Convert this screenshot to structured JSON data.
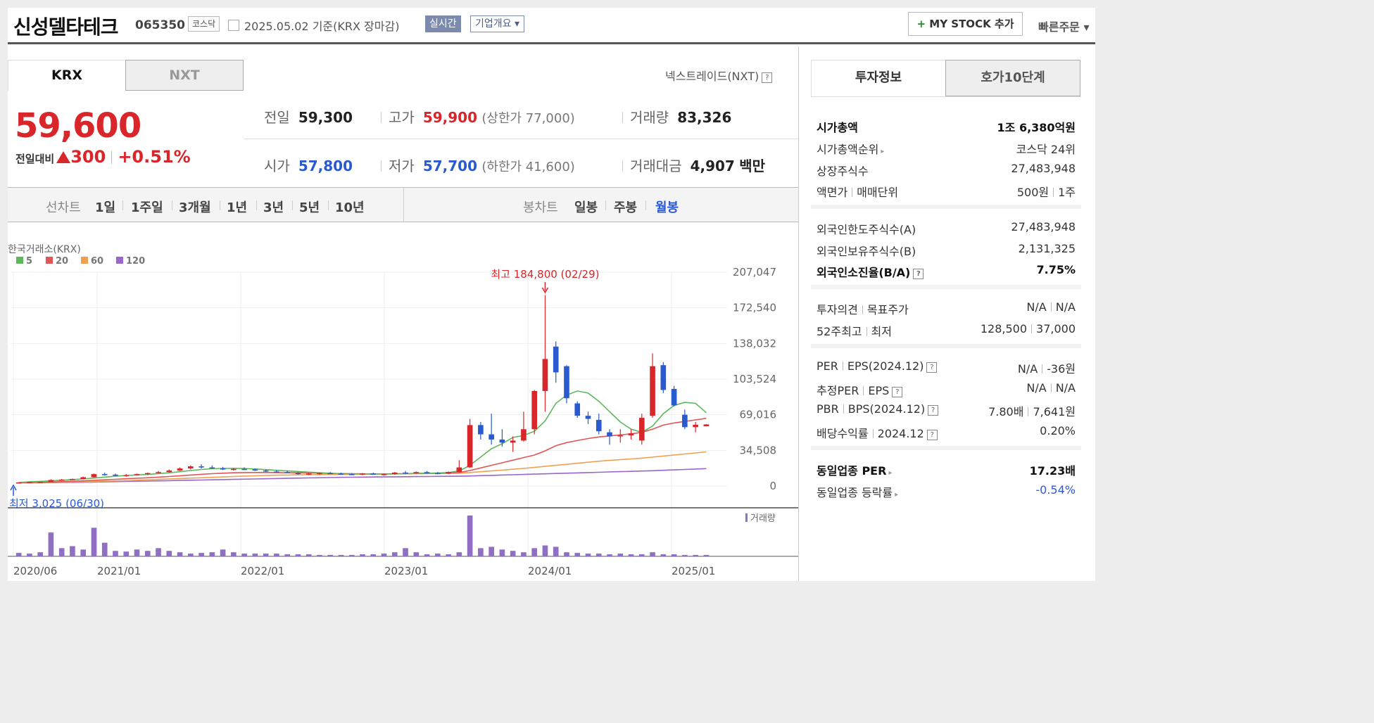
{
  "header": {
    "name": "신성델타테크",
    "code": "065350",
    "market": "코스닥",
    "date": "2025.05.02  기준(KRX 장마감)",
    "realtime_label": "실시간",
    "corp_label": "기업개요 ▾",
    "mystock_plus": "+",
    "mystock_label": "MY STOCK 추가",
    "quick_label": "빠른주문 ▾"
  },
  "tabs": {
    "krx": "KRX",
    "nxt": "NXT",
    "nxt_link": "넥스트레이드(NXT)",
    "help": "?"
  },
  "price": {
    "current": "59,600",
    "change_label": "전일대비",
    "change": "300",
    "rate": "+0.51%"
  },
  "quote": {
    "prev_label": "전일",
    "prev": "59,300",
    "high_label": "고가",
    "high": "59,900",
    "upper": "(상한가 77,000)",
    "volume_label": "거래량",
    "volume": "83,326",
    "open_label": "시가",
    "open": "57,800",
    "low_label": "저가",
    "low": "57,700",
    "lower": "(하한가 41,600)",
    "amount_label": "거래대금",
    "amount": "4,907",
    "amount_unit": "백만"
  },
  "periods": {
    "line_label": "선차트",
    "line_items": [
      "1일",
      "1주일",
      "3개월",
      "1년",
      "3년",
      "5년",
      "10년"
    ],
    "candle_label": "봉차트",
    "candle_items": [
      "일봉",
      "주봉",
      "월봉"
    ],
    "selected": "월봉"
  },
  "chart_data": {
    "type": "candlestick",
    "source_label": "한국거래소(KRX)",
    "legend": [
      {
        "name": "5",
        "color": "#5cb85c"
      },
      {
        "name": "20",
        "color": "#e05555"
      },
      {
        "name": "60",
        "color": "#f0a050"
      },
      {
        "name": "120",
        "color": "#9966cc"
      }
    ],
    "y_ticks": [
      "207,047",
      "172,540",
      "138,032",
      "103,524",
      "69,016",
      "34,508",
      "0"
    ],
    "ylim": [
      0,
      207047
    ],
    "x_ticks": [
      "2020/06",
      "2021/01",
      "2022/01",
      "2023/01",
      "2024/01",
      "2025/01"
    ],
    "max_label": "최고 184,800 (02/29)",
    "min_label": "최저 3,025 (06/30)",
    "volume_label": "거래량",
    "up_color": "#d8262b",
    "down_color": "#2a5ad0",
    "candles": [
      [
        3100,
        3500,
        3000,
        3400
      ],
      [
        3400,
        4000,
        3300,
        3800
      ],
      [
        3800,
        4200,
        3500,
        3900
      ],
      [
        3900,
        6500,
        3800,
        5800
      ],
      [
        5800,
        6800,
        5200,
        6200
      ],
      [
        6200,
        7200,
        5800,
        6800
      ],
      [
        6800,
        9000,
        6500,
        8500
      ],
      [
        8500,
        12000,
        8000,
        11500
      ],
      [
        11500,
        13000,
        10000,
        11000
      ],
      [
        11000,
        12000,
        9500,
        10000
      ],
      [
        10000,
        11500,
        9000,
        10500
      ],
      [
        10500,
        12000,
        10000,
        11500
      ],
      [
        11500,
        13000,
        10500,
        12500
      ],
      [
        12500,
        14500,
        12000,
        13500
      ],
      [
        13500,
        16000,
        13000,
        15000
      ],
      [
        15000,
        18000,
        14500,
        17000
      ],
      [
        17000,
        20000,
        16000,
        19000
      ],
      [
        19000,
        21000,
        17000,
        18000
      ],
      [
        18000,
        20000,
        16500,
        17000
      ],
      [
        17000,
        18500,
        15500,
        16000
      ],
      [
        16000,
        17500,
        15000,
        16500
      ],
      [
        16500,
        18000,
        15500,
        16000
      ],
      [
        16000,
        17000,
        14500,
        15000
      ],
      [
        15000,
        16000,
        13500,
        14000
      ],
      [
        14000,
        15500,
        13000,
        13500
      ],
      [
        13500,
        15000,
        12500,
        12500
      ],
      [
        12500,
        13500,
        11000,
        11500
      ],
      [
        11500,
        12500,
        10500,
        12000
      ],
      [
        12000,
        13000,
        11000,
        12500
      ],
      [
        12500,
        13500,
        11500,
        12000
      ],
      [
        12000,
        13000,
        11000,
        11500
      ],
      [
        11500,
        12500,
        10500,
        11000
      ],
      [
        11000,
        12500,
        10500,
        12000
      ],
      [
        12000,
        13000,
        11000,
        11000
      ],
      [
        11000,
        12000,
        10000,
        11500
      ],
      [
        11500,
        13500,
        11000,
        13000
      ],
      [
        13000,
        14500,
        12000,
        12500
      ],
      [
        12500,
        14000,
        12000,
        13500
      ],
      [
        13500,
        14500,
        12000,
        12500
      ],
      [
        12500,
        13500,
        11500,
        12000
      ],
      [
        12000,
        14000,
        11500,
        13500
      ],
      [
        13500,
        25000,
        13000,
        18000
      ],
      [
        18000,
        65000,
        17500,
        59000
      ],
      [
        59000,
        62000,
        45000,
        50000
      ],
      [
        50000,
        70000,
        40000,
        45000
      ],
      [
        45000,
        55000,
        38000,
        42000
      ],
      [
        42000,
        48000,
        33000,
        44000
      ],
      [
        44000,
        72000,
        43000,
        55000
      ],
      [
        55000,
        93000,
        50000,
        92000
      ],
      [
        92000,
        184800,
        72000,
        123000
      ],
      [
        135000,
        140000,
        100000,
        110000
      ],
      [
        116000,
        117000,
        80000,
        85000
      ],
      [
        80000,
        82000,
        66000,
        68000
      ],
      [
        68000,
        72000,
        60000,
        65000
      ],
      [
        64000,
        70000,
        50000,
        53000
      ],
      [
        52000,
        55000,
        40000,
        48000
      ],
      [
        48000,
        55000,
        42000,
        49000
      ],
      [
        49000,
        55000,
        45000,
        51000
      ],
      [
        44000,
        70000,
        40000,
        66000
      ],
      [
        68000,
        128500,
        66000,
        116000
      ],
      [
        117000,
        120000,
        90000,
        93000
      ],
      [
        94000,
        97000,
        77000,
        78000
      ],
      [
        69000,
        74000,
        55000,
        57000
      ],
      [
        57000,
        62000,
        52000,
        59300
      ],
      [
        57800,
        59900,
        57700,
        59600
      ]
    ],
    "ma5": [
      3400,
      4000,
      4500,
      5000,
      5600,
      6200,
      6900,
      7700,
      8600,
      9500,
      10100,
      10700,
      11200,
      12000,
      12800,
      13800,
      15000,
      16000,
      16700,
      17000,
      17100,
      16900,
      16500,
      15900,
      15200,
      14600,
      14000,
      13400,
      12800,
      12300,
      12000,
      11800,
      11700,
      11600,
      11600,
      11700,
      11900,
      12200,
      12400,
      12600,
      13000,
      14500,
      20000,
      28000,
      36000,
      41000,
      47000,
      49000,
      53000,
      63000,
      80000,
      88000,
      92000,
      90000,
      82000,
      72000,
      62000,
      55000,
      52000,
      58000,
      70000,
      78000,
      81000,
      80000,
      71000
    ],
    "ma20": [
      3200,
      3400,
      3600,
      3900,
      4200,
      4600,
      5000,
      5500,
      6000,
      6500,
      7000,
      7500,
      8000,
      8600,
      9200,
      9900,
      10600,
      11300,
      11900,
      12400,
      12800,
      13000,
      13100,
      13100,
      13000,
      12900,
      12800,
      12600,
      12400,
      12200,
      12000,
      11900,
      11800,
      11700,
      11700,
      11800,
      11900,
      12100,
      12300,
      12400,
      12600,
      13000,
      15000,
      17500,
      20000,
      22500,
      25000,
      27500,
      30000,
      34000,
      39000,
      42000,
      44000,
      46000,
      47500,
      48500,
      49500,
      50500,
      52000,
      55000,
      59000,
      61000,
      62500,
      64000,
      65500
    ],
    "ma60": [
      3100,
      3200,
      3300,
      3400,
      3600,
      3800,
      4000,
      4300,
      4600,
      4900,
      5200,
      5600,
      6000,
      6400,
      6800,
      7200,
      7600,
      8000,
      8400,
      8800,
      9200,
      9600,
      9900,
      10200,
      10400,
      10600,
      10800,
      10900,
      11000,
      11100,
      11200,
      11300,
      11400,
      11500,
      11600,
      11700,
      11800,
      11900,
      12000,
      12100,
      12200,
      12400,
      13000,
      13800,
      14600,
      15400,
      16200,
      17000,
      18000,
      19000,
      20000,
      21000,
      22000,
      23000,
      24000,
      24800,
      25500,
      26200,
      27000,
      28000,
      29000,
      30000,
      31000,
      32000,
      33000
    ],
    "ma120": [
      3000,
      3100,
      3200,
      3300,
      3400,
      3500,
      3600,
      3800,
      4000,
      4200,
      4400,
      4600,
      4800,
      5000,
      5200,
      5400,
      5600,
      5800,
      6000,
      6200,
      6400,
      6600,
      6800,
      7000,
      7200,
      7400,
      7600,
      7800,
      8000,
      8200,
      8400,
      8500,
      8600,
      8700,
      8800,
      8900,
      9000,
      9100,
      9200,
      9300,
      9400,
      9500,
      9700,
      10000,
      10300,
      10600,
      10900,
      11200,
      11500,
      11800,
      12100,
      12400,
      12700,
      13000,
      13300,
      13600,
      13900,
      14200,
      14500,
      14800,
      15200,
      15600,
      16000,
      16400,
      16800
    ],
    "volumes": [
      5,
      4,
      6,
      35,
      12,
      15,
      10,
      42,
      20,
      8,
      7,
      10,
      8,
      12,
      8,
      6,
      4,
      5,
      6,
      10,
      6,
      4,
      4,
      4,
      4,
      3,
      3,
      3,
      2,
      2,
      2,
      2,
      3,
      3,
      4,
      6,
      12,
      6,
      3,
      4,
      3,
      6,
      60,
      12,
      14,
      10,
      8,
      6,
      12,
      16,
      14,
      6,
      5,
      4,
      4,
      3,
      4,
      3,
      3,
      6,
      3,
      3,
      2,
      2,
      2
    ]
  },
  "invest": {
    "tab_active": "투자정보",
    "tab_inactive": "호가10단계",
    "market_cap_label": "시가총액",
    "market_cap": "1조 6,380억원",
    "rank_label": "시가총액순위",
    "rank": "코스닥 24위",
    "shares_label": "상장주식수",
    "shares": "27,483,948",
    "par_label": "액면가",
    "unit_label": "매매단위",
    "par": "500원",
    "unit": "1주",
    "foreign_limit_label": "외국인한도주식수(A)",
    "foreign_limit": "27,483,948",
    "foreign_hold_label": "외국인보유주식수(B)",
    "foreign_hold": "2,131,325",
    "foreign_ratio_label": "외국인소진율(B/A)",
    "foreign_ratio": "7.75%",
    "opinion_label": "투자의견",
    "target_label": "목표주가",
    "opinion": "N/A",
    "target": "N/A",
    "w52_label": "52주최고",
    "w52_low_label": "최저",
    "w52_high": "128,500",
    "w52_low": "37,000",
    "per_label": "PER",
    "eps_label": "EPS(2024.12)",
    "per": "N/A",
    "eps": "-36원",
    "eper_label": "추정PER",
    "eeps_label": "EPS",
    "eper": "N/A",
    "eeps": "N/A",
    "pbr_label": "PBR",
    "bps_label": "BPS(2024.12)",
    "pbr": "7.80배",
    "bps": "7,641원",
    "div_label": "배당수익률",
    "div_date": "2024.12",
    "div": "0.20%",
    "sector_per_label": "동일업종 PER",
    "sector_per": "17.23배",
    "sector_rate_label": "동일업종 등락률",
    "sector_rate": "-0.54%"
  }
}
